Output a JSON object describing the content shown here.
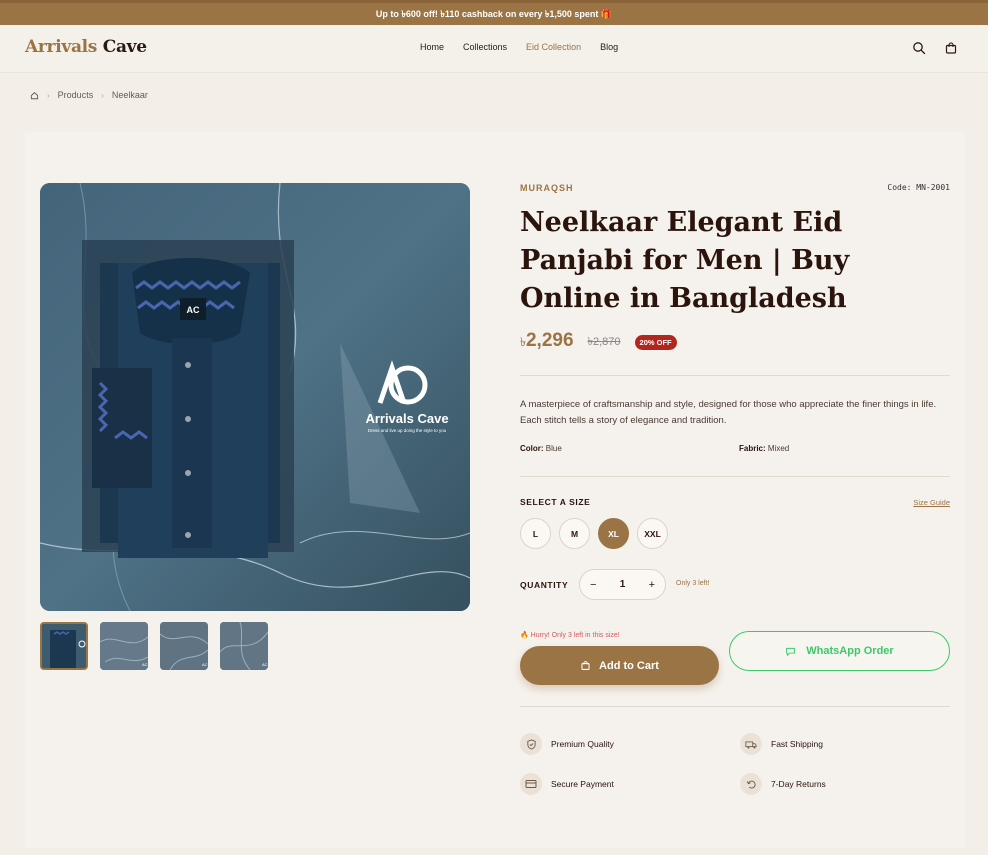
{
  "promo": {
    "text": "Up to ৳600 off! ৳110 cashback on every ৳1,500 spent 🎁"
  },
  "header": {
    "logo_part1": "Arrivals",
    "logo_part2": "Cave",
    "nav": [
      {
        "label": "Home",
        "active": false
      },
      {
        "label": "Collections",
        "active": false
      },
      {
        "label": "Eid Collection",
        "active": true
      },
      {
        "label": "Blog",
        "active": false
      }
    ],
    "icons": [
      "search-icon",
      "bag-icon"
    ]
  },
  "breadcrumb": {
    "items": [
      "Products",
      "Neelkaar"
    ]
  },
  "product": {
    "brand": "MURAQSH",
    "code": "Code: MN-2001",
    "title": "Neelkaar Elegant Eid Panjabi for Men | Buy Online in Bangladesh",
    "price_symbol": "৳",
    "price": "2,296",
    "old_price": "৳2,870",
    "discount": "20% OFF",
    "description": "A masterpiece of craftsmanship and style, designed for those who appreciate the finer things in life. Each stitch tells a story of elegance and tradition.",
    "color_label": "Color:",
    "color_value": "Blue",
    "fabric_label": "Fabric:",
    "fabric_value": "Mixed",
    "size_label": "SELECT A SIZE",
    "size_guide": "Size Guide",
    "sizes": [
      "L",
      "M",
      "XL",
      "XXL"
    ],
    "selected_size": "XL",
    "quantity_label": "QUANTITY",
    "quantity": "1",
    "qty_minus": "−",
    "qty_plus": "+",
    "stock_note": "Only 3 left!",
    "hurry_note": "🔥 Hurry! Only 3 left in this size!",
    "add_to_cart": "Add to Cart",
    "whatsapp": "WhatsApp Order",
    "image_logo_text": "Arrivals Cave",
    "image_tagline": "Dress and live up doing the style to you",
    "features": [
      {
        "label": "Premium Quality",
        "icon": "shield-icon"
      },
      {
        "label": "Fast Shipping",
        "icon": "truck-icon"
      },
      {
        "label": "Secure Payment",
        "icon": "card-icon"
      },
      {
        "label": "7-Day Returns",
        "icon": "return-icon"
      }
    ]
  },
  "colors": {
    "accent": "#9b7446",
    "whatsapp": "#3ec86b",
    "sale": "#b3261e"
  }
}
